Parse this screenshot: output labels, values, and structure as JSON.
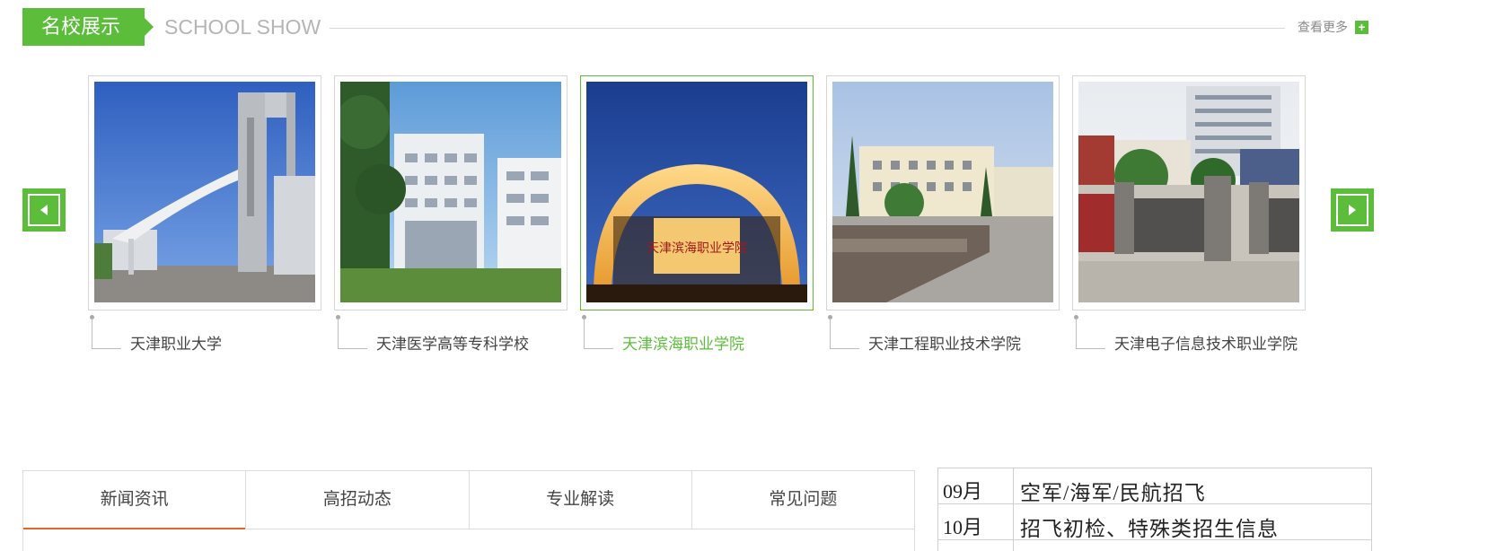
{
  "section": {
    "title_cn": "名校展示",
    "title_en": "SCHOOL SHOW",
    "more_label": "查看更多",
    "more_icon": "plus-icon",
    "accent_color": "#5bbd3a"
  },
  "carousel": {
    "prev_icon": "triangle-left-icon",
    "next_icon": "triangle-right-icon",
    "schools": [
      {
        "name": "天津职业大学",
        "active": false
      },
      {
        "name": "天津医学高等专科学校",
        "active": false
      },
      {
        "name": "天津滨海职业学院",
        "active": true
      },
      {
        "name": "天津工程职业技术学院",
        "active": false
      },
      {
        "name": "天津电子信息技术职业学院",
        "active": false
      }
    ]
  },
  "tabs": [
    {
      "label": "新闻资讯",
      "active": true
    },
    {
      "label": "高招动态",
      "active": false
    },
    {
      "label": "专业解读",
      "active": false
    },
    {
      "label": "常见问题",
      "active": false
    }
  ],
  "tab_active_color": "#e0662a",
  "schedule": [
    {
      "month": "09月",
      "desc": "空军/海军/民航招飞"
    },
    {
      "month": "10月",
      "desc": "招飞初检、特殊类招生信息"
    }
  ]
}
